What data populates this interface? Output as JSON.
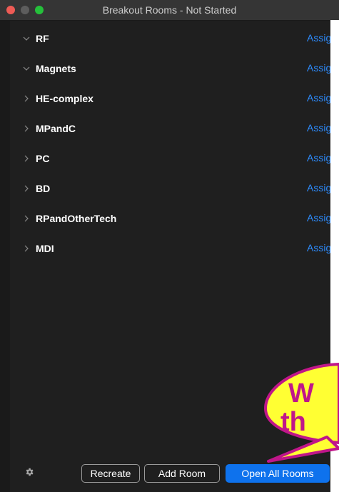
{
  "window": {
    "title": "Breakout Rooms - Not Started"
  },
  "rooms": [
    {
      "name": "RF",
      "expanded": true,
      "action": "Assign"
    },
    {
      "name": "Magnets",
      "expanded": true,
      "action": "Assign"
    },
    {
      "name": "HE-complex",
      "expanded": false,
      "action": "Assign"
    },
    {
      "name": "MPandC",
      "expanded": false,
      "action": "Assign"
    },
    {
      "name": "PC",
      "expanded": false,
      "action": "Assign"
    },
    {
      "name": "BD",
      "expanded": false,
      "action": "Assign"
    },
    {
      "name": "RPandOtherTech",
      "expanded": false,
      "action": "Assign"
    },
    {
      "name": "MDI",
      "expanded": false,
      "action": "Assign"
    }
  ],
  "footer": {
    "settings_icon": "gear-icon",
    "recreate_label": "Recreate",
    "add_room_label": "Add Room",
    "open_all_label": "Open All Rooms"
  },
  "callout": {
    "line1": "W",
    "line2": "th",
    "fill_color": "#ffff33",
    "border_color": "#c0168a"
  },
  "colors": {
    "accent": "#2d8cff",
    "primary_button": "#0e72ed",
    "background": "#1f1f1f"
  }
}
